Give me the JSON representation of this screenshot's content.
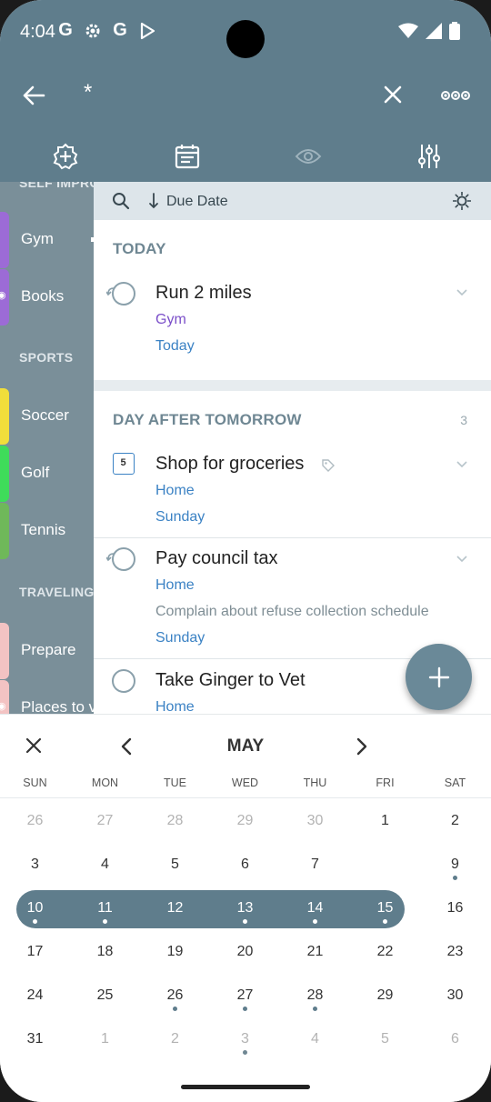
{
  "status_bar": {
    "time": "4:04",
    "left_icons": [
      "G",
      "gear-icon",
      "G",
      "play-store-icon"
    ],
    "right_icons": [
      "wifi-icon",
      "signal-icon",
      "battery-icon"
    ]
  },
  "toolbar": {
    "search_query": "*",
    "icons": [
      "back-arrow-icon",
      "close-icon",
      "more-options-icon"
    ]
  },
  "tabs": [
    "add-circle-icon",
    "calendar-list-icon",
    "eye-icon",
    "sliders-icon"
  ],
  "sidebar": {
    "cut_top_label": "SELF IMPRO",
    "items": [
      {
        "label": "Gym",
        "color": "#9c6bd6"
      },
      {
        "label": "Books",
        "color": "#9c6bd6"
      },
      {
        "label": "Soccer",
        "color": "#f1de3b"
      },
      {
        "label": "Golf",
        "color": "#3fdc5a"
      },
      {
        "label": "Tennis",
        "color": "#6fb85a"
      },
      {
        "label": "Prepare",
        "color": "#f3c3c3"
      },
      {
        "label": "Places to v",
        "color": "#f3c3c3"
      }
    ],
    "headers": [
      "SPORTS",
      "TRAVELING"
    ]
  },
  "sort_bar": {
    "label": "Due Date"
  },
  "sections": [
    {
      "title": "TODAY",
      "tasks": [
        {
          "title": "Run 2 miles",
          "list": "Gym",
          "list_color": "#7b4fc9",
          "due": "Today"
        }
      ]
    },
    {
      "title": "DAY AFTER TOMORROW",
      "count": "3",
      "tasks": [
        {
          "title": "Shop for groceries",
          "list": "Home",
          "due": "Sunday",
          "icon_day": "5"
        },
        {
          "title": "Pay council tax",
          "list": "Home",
          "note": "Complain about refuse collection schedule",
          "due": "Sunday"
        },
        {
          "title": "Take Ginger to Vet",
          "list": "Home"
        }
      ]
    }
  ],
  "calendar": {
    "month": "MAY",
    "weekdays": [
      "SUN",
      "MON",
      "TUE",
      "WED",
      "THU",
      "FRI",
      "SAT"
    ],
    "weeks": [
      [
        "26",
        "27",
        "28",
        "29",
        "30",
        "1",
        "2"
      ],
      [
        "3",
        "4",
        "5",
        "6",
        "7",
        "",
        "9"
      ],
      [
        "10",
        "11",
        "12",
        "13",
        "14",
        "15",
        "16"
      ],
      [
        "17",
        "18",
        "19",
        "20",
        "21",
        "22",
        "23"
      ],
      [
        "24",
        "25",
        "26",
        "27",
        "28",
        "29",
        "30"
      ],
      [
        "31",
        "1",
        "2",
        "3",
        "4",
        "5",
        "6"
      ]
    ],
    "selected_range": [
      "10",
      "11",
      "12",
      "13",
      "14",
      "15"
    ],
    "accent": "#5f7d8c"
  }
}
